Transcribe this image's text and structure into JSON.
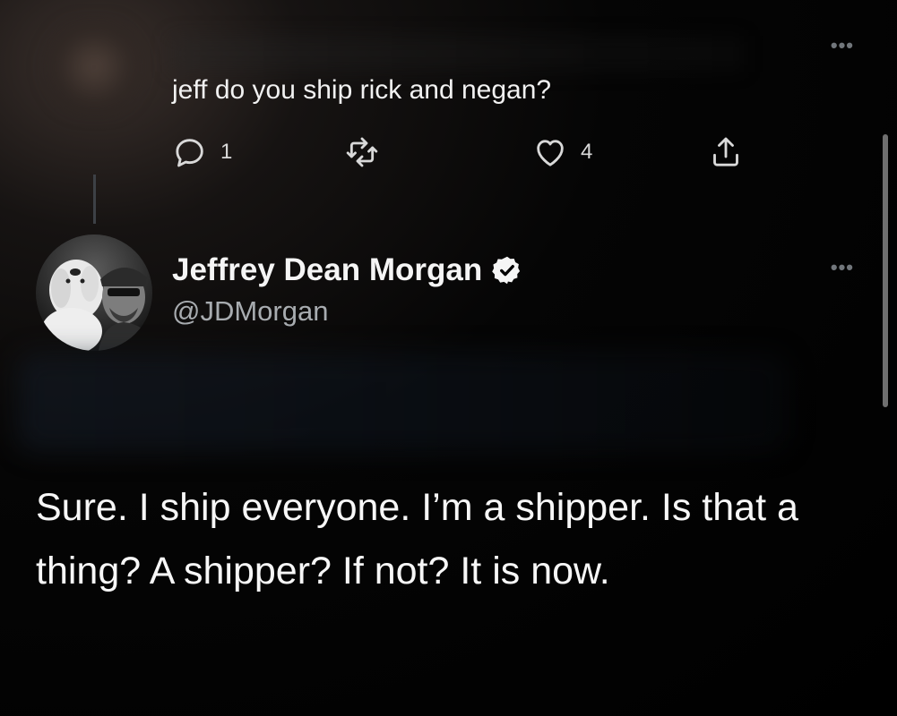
{
  "reply": {
    "text": "jeff do you ship rick and negan?",
    "reply_count": "1",
    "retweet_count": "",
    "like_count": "4"
  },
  "author": {
    "name": "Jeffrey Dean Morgan",
    "handle": "@JDMorgan"
  },
  "tweet": {
    "text": "Sure. I ship everyone. I’m a shipper. Is that a thing? A shipper? If not? It is now."
  },
  "icons": {
    "reply": "reply-icon",
    "retweet": "retweet-icon",
    "like": "heart-icon",
    "share": "share-icon",
    "more": "more-icon",
    "verified": "verified-badge-icon"
  },
  "colors": {
    "background": "#000000",
    "text": "#f7f7f7",
    "secondary_text": "#a8acb0"
  }
}
